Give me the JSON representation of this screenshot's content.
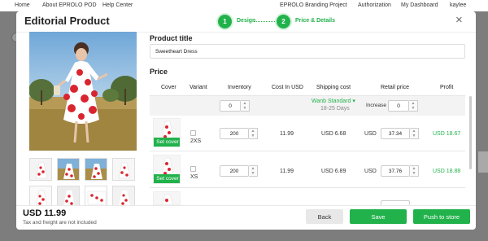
{
  "bg_nav": {
    "items": [
      "Home",
      "About EPROLO POD",
      "Help Center",
      "EPROLO Branding Project",
      "Authorization",
      "My Dashboard",
      "kaylee"
    ]
  },
  "modal": {
    "title": "Editorial Product",
    "close_icon": "×",
    "steps": [
      {
        "number": "1",
        "label": "Design"
      },
      {
        "number": "2",
        "label": "Price & Details"
      }
    ]
  },
  "product_title": {
    "label": "Product title",
    "value": "Sweetheart Dress"
  },
  "price_section": {
    "label": "Price",
    "headers": [
      "Cover",
      "Variant",
      "Inventory",
      "Cost In USD",
      "Shipping cost",
      "Retail price",
      "Profit"
    ],
    "batch": {
      "inventory": "0",
      "shipping_method": "Wanb Standard",
      "shipping_days": "18-25 Days",
      "increase_label": "Increase",
      "increase_value": "0"
    },
    "rows": [
      {
        "set_cover": "Set cover",
        "variant": "2XS",
        "inventory": "200",
        "cost": "11.99",
        "shipping": "USD 6.68",
        "currency": "USD",
        "retail": "37.34",
        "profit": "USD 18.67"
      },
      {
        "set_cover": "Set cover",
        "variant": "XS",
        "inventory": "200",
        "cost": "11.99",
        "shipping": "USD 6.89",
        "currency": "USD",
        "retail": "37.76",
        "profit": "USD 18.88"
      }
    ]
  },
  "footer": {
    "price": "USD 11.99",
    "note": "Tax and freight are not included",
    "back_label": "Back",
    "save_label": "Save",
    "push_label": "Push to store"
  },
  "colors": {
    "accent": "#22b24c",
    "dress_red": "#d9252f"
  }
}
